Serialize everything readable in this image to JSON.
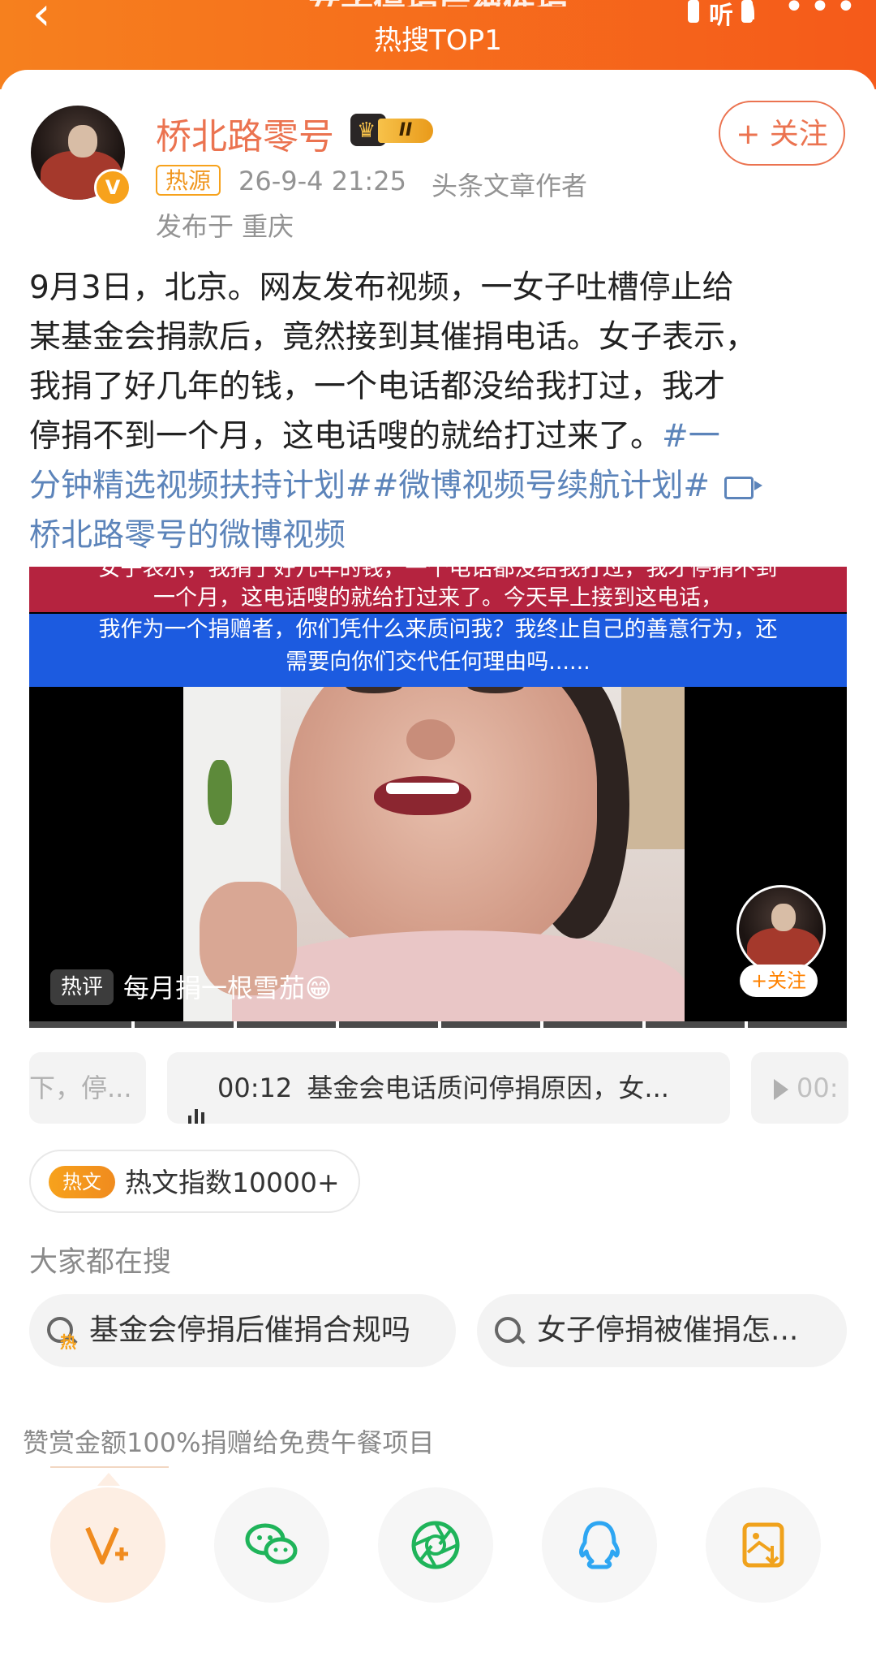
{
  "header": {
    "title": "女子停捐后被催捐",
    "subtitle": "热搜TOP1",
    "listen_label": "听"
  },
  "post": {
    "author": "桥北路零号",
    "level_badge": "II",
    "follow_label": "+ 关注",
    "source_tag": "热源",
    "datetime": "26-9-4 21:25",
    "author_title": "头条文章作者",
    "location": "发布于 重庆",
    "body_lines": [
      "9月3日，北京。网友发布视频，一女子吐槽停止给",
      "某基金会捐款后，竟然接到其催捐电话。女子表示，",
      "我捐了好几年的钱，一个电话都没给我打过，我才",
      "停捐不到一个月，这电话嗖的就给打过来了。"
    ],
    "hashtag_1_part1": "#一",
    "hashtag_1_part2": "分钟精选视频扶持计划#",
    "hashtag_2": "#微博视频号续航计划#",
    "video_link": "桥北路零号的微博视频"
  },
  "video": {
    "subtitle_red_line1": "女子表示，我捐了好几年的钱，一个电话都没给我打过，我才停捐不到",
    "subtitle_red_line2": "一个月，这电话嗖的就给打过来了。今天早上接到这电话，",
    "subtitle_blue_line1": "我作为一个捐赠者，你们凭什么来质问我？我终止自己的善意行为，还",
    "subtitle_blue_line2": "需要向你们交代任何理由吗......",
    "hot_comment_tag": "热评",
    "hot_comment": "每月捐一根雪茄😁",
    "follow_label": "+关注"
  },
  "chapters": {
    "left_text": "下，停...",
    "mid_time": "00:12",
    "mid_text": "基金会电话质问停捐原因，女...",
    "right_text": "00:"
  },
  "hot_index": {
    "badge": "热文",
    "label": "热文指数10000+"
  },
  "searches": {
    "title": "大家都在搜",
    "hot_mini": "热",
    "items": [
      "基金会停捐后催捐合规吗",
      "女子停捐被催捐怎..."
    ]
  },
  "reward_note": "赞赏金额100%捐赠给免费午餐项目",
  "actions": [
    {
      "icon": "reward-v-plus-icon",
      "color": "#f08b1e"
    },
    {
      "icon": "wechat-icon",
      "color": "#1fb45a"
    },
    {
      "icon": "moments-icon",
      "color": "#1fb45a"
    },
    {
      "icon": "qq-icon",
      "color": "#2ea6f2"
    },
    {
      "icon": "save-image-icon",
      "color": "#f0a21c"
    }
  ]
}
